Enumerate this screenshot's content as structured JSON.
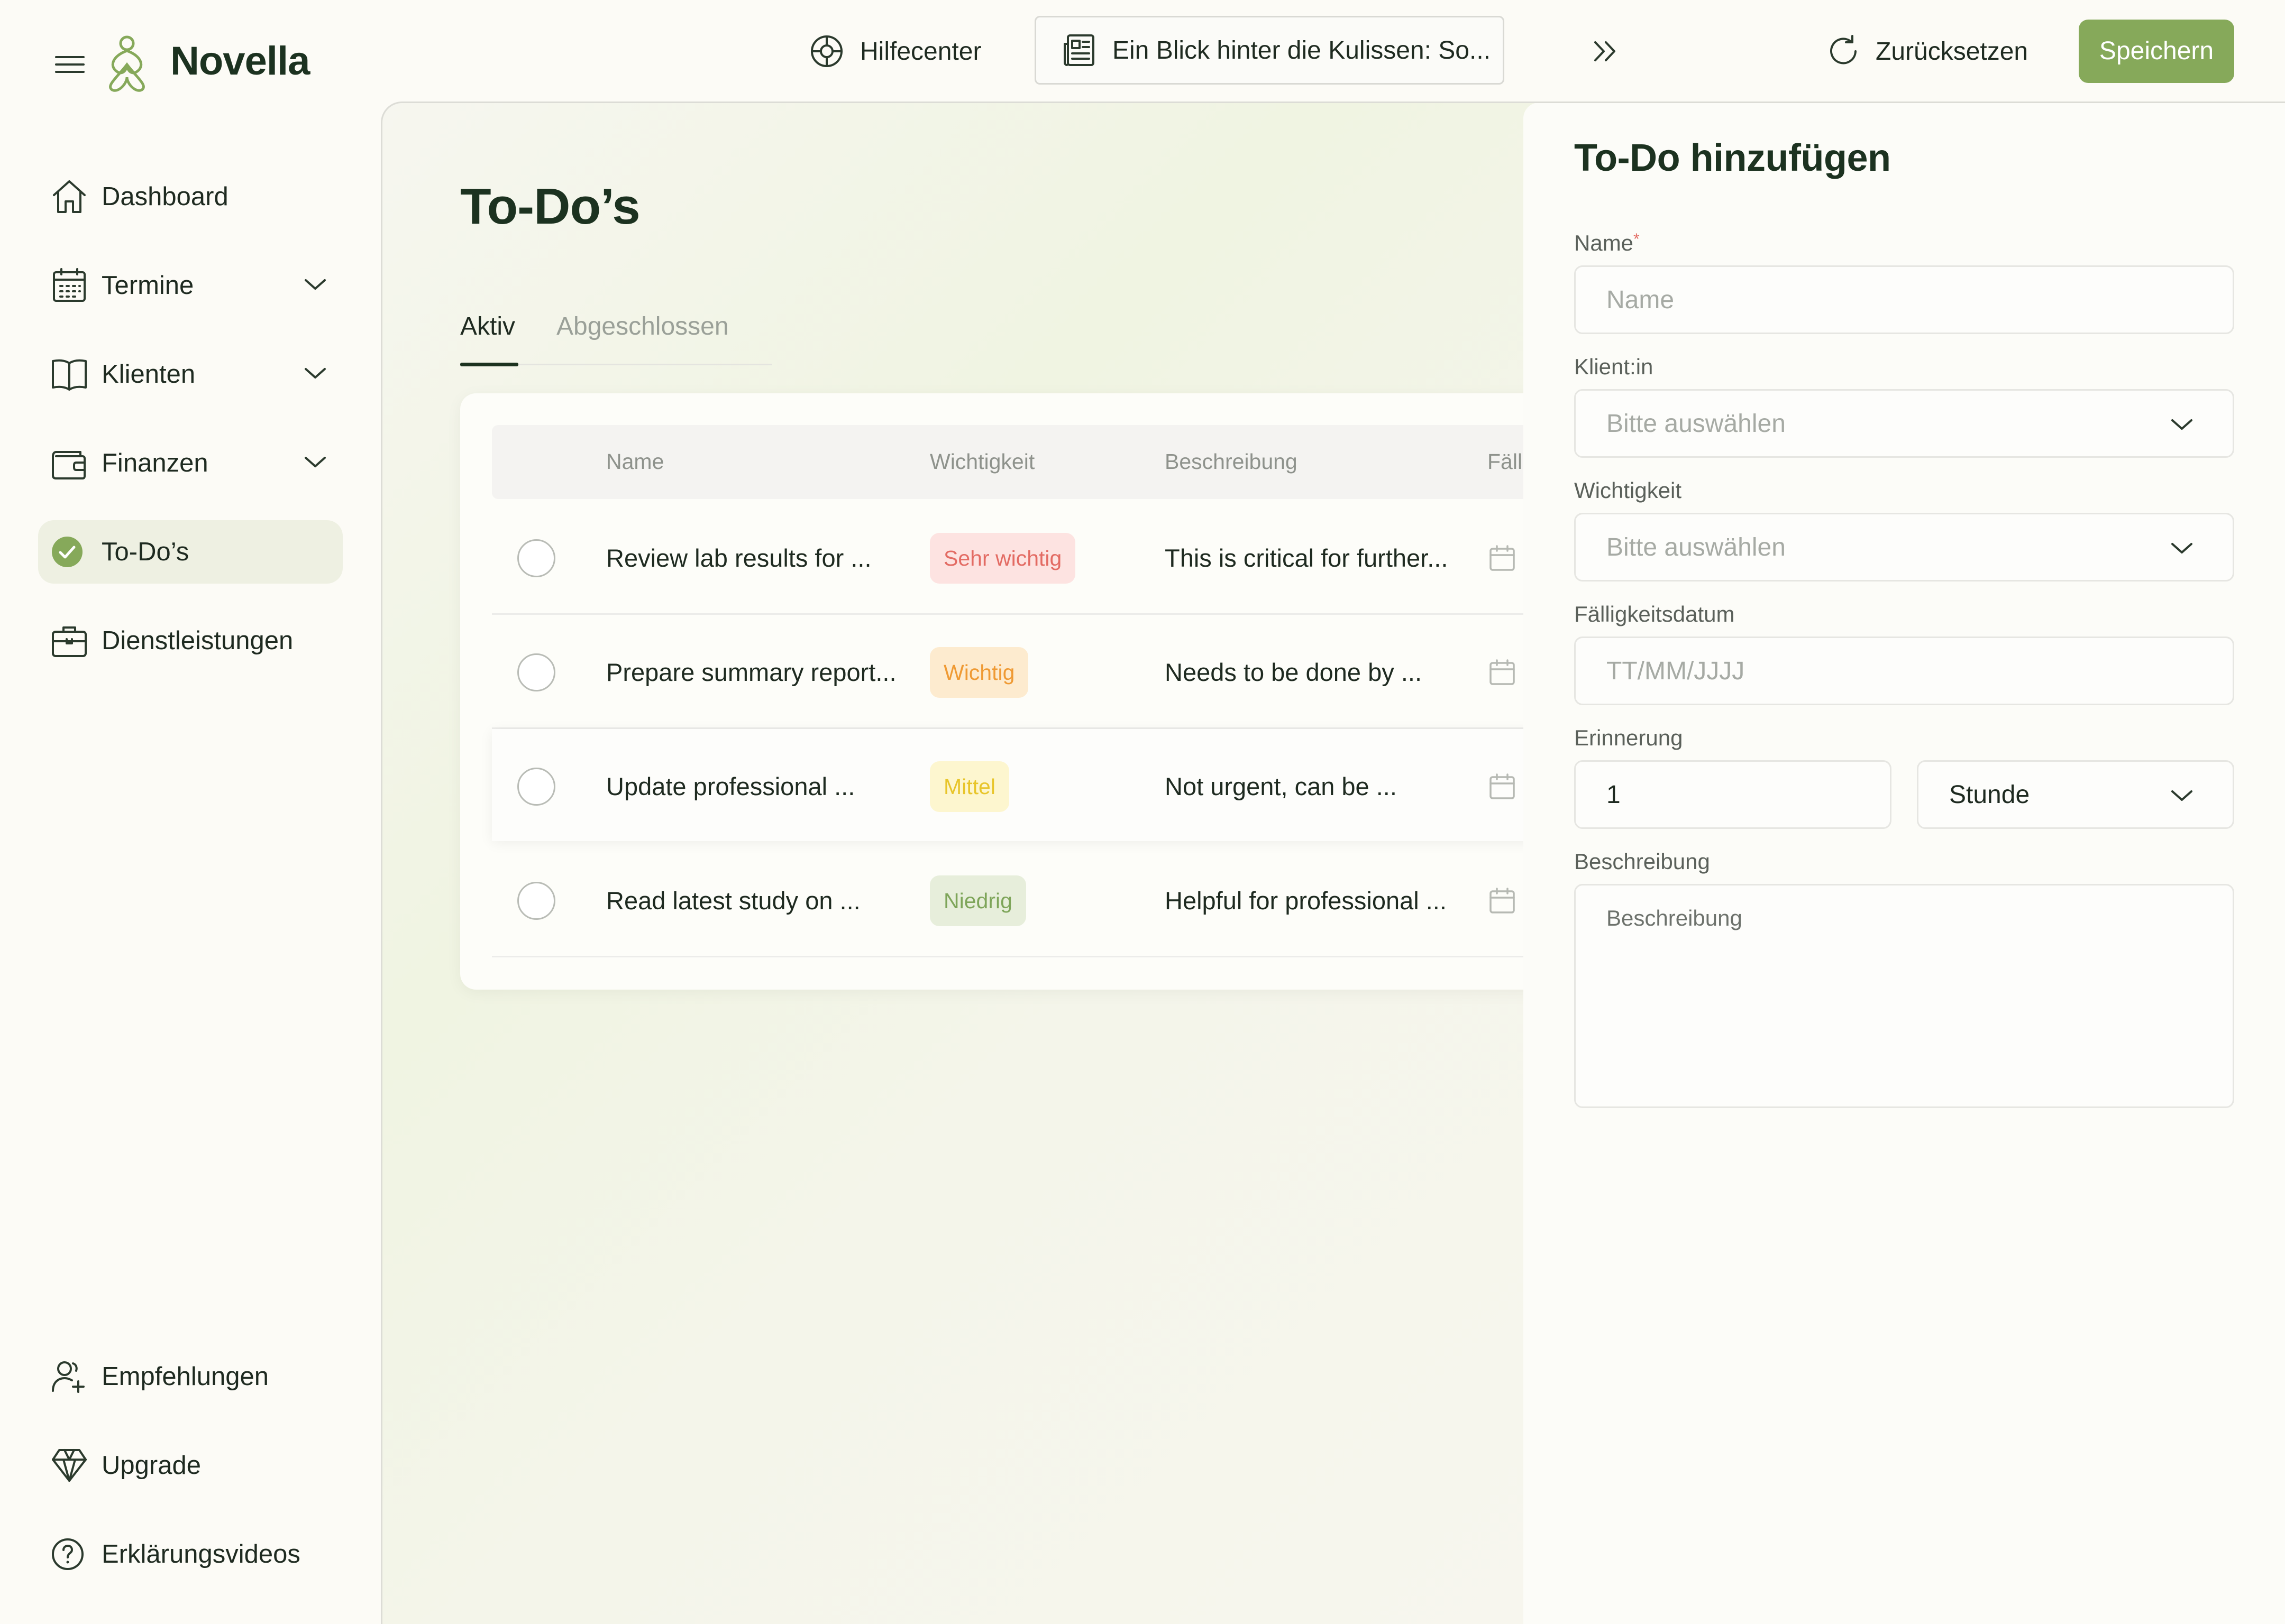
{
  "app": {
    "name": "Novella"
  },
  "topbar": {
    "help_label": "Hilfecenter",
    "news_label": "Ein Blick hinter die Kulissen: So...",
    "reset_label": "Zurücksetzen",
    "save_label": "Speichern"
  },
  "sidebar": {
    "items": [
      {
        "label": "Dashboard",
        "icon": "home-icon"
      },
      {
        "label": "Termine",
        "icon": "calendar-icon",
        "expandable": true
      },
      {
        "label": "Klienten",
        "icon": "book-icon",
        "expandable": true
      },
      {
        "label": "Finanzen",
        "icon": "wallet-icon",
        "expandable": true
      },
      {
        "label": "To-Do’s",
        "icon": "check-circle-icon",
        "active": true
      },
      {
        "label": "Dienstleistungen",
        "icon": "briefcase-icon"
      }
    ],
    "bottom_items": [
      {
        "label": "Empfehlungen",
        "icon": "user-plus-icon"
      },
      {
        "label": "Upgrade",
        "icon": "diamond-icon"
      },
      {
        "label": "Erklärungsvideos",
        "icon": "help-circle-icon"
      }
    ]
  },
  "main": {
    "title": "To-Do’s",
    "tabs": [
      {
        "label": "Aktiv",
        "active": true
      },
      {
        "label": "Abgeschlossen",
        "active": false
      }
    ],
    "table": {
      "columns": [
        "Name",
        "Wichtigkeit",
        "Beschreibung",
        "Fäll"
      ],
      "rows": [
        {
          "name": "Review lab results for ...",
          "priority": "Sehr wichtig",
          "priority_level": "very-high",
          "description": "This is critical for further..."
        },
        {
          "name": "Prepare summary report...",
          "priority": "Wichtig",
          "priority_level": "high",
          "description": "Needs to be done by ..."
        },
        {
          "name": "Update professional ...",
          "priority": "Mittel",
          "priority_level": "medium",
          "description": "Not urgent, can be ..."
        },
        {
          "name": "Read latest study on ...",
          "priority": "Niedrig",
          "priority_level": "low",
          "description": "Helpful for professional ..."
        }
      ]
    }
  },
  "drawer": {
    "title": "To-Do hinzufügen",
    "fields": {
      "name": {
        "label": "Name",
        "required_mark": "*",
        "placeholder": "Name"
      },
      "client": {
        "label": "Klient:in",
        "placeholder": "Bitte auswählen"
      },
      "priority": {
        "label": "Wichtigkeit",
        "placeholder": "Bitte auswählen"
      },
      "due_date": {
        "label": "Fälligkeitsdatum",
        "placeholder": "TT/MM/JJJJ"
      },
      "reminder": {
        "label": "Erinnerung",
        "value": "1",
        "unit": "Stunde"
      },
      "description": {
        "label": "Beschreibung",
        "placeholder": "Beschreibung"
      }
    }
  },
  "colors": {
    "accent": "#86a95a",
    "badge_very_high_bg": "#fde3e1",
    "badge_very_high_fg": "#e36b63",
    "badge_high_bg": "#fdebcf",
    "badge_high_fg": "#ef9a34",
    "badge_medium_bg": "#fdf6cf",
    "badge_medium_fg": "#e8c52a",
    "badge_low_bg": "#e7eedb",
    "badge_low_fg": "#7ea55a"
  }
}
